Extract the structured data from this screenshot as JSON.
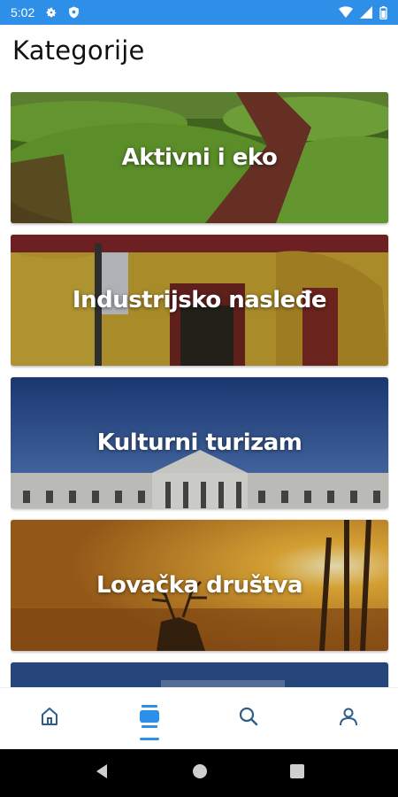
{
  "status_bar": {
    "time": "5:02",
    "icons": [
      "gear-icon",
      "shield-icon",
      "wifi-icon",
      "signal-icon",
      "battery-icon"
    ],
    "background": "#2e8fe8"
  },
  "header": {
    "title": "Kategorije"
  },
  "categories": [
    {
      "label": "Aktivni i eko",
      "image": "green hills with path"
    },
    {
      "label": "Industrijsko nasleđe",
      "image": "yellow historic building"
    },
    {
      "label": "Kulturni turizam",
      "image": "white palace under blue sky"
    },
    {
      "label": "Lovačka društva",
      "image": "deer at sunset"
    },
    {
      "label": "",
      "image": "partially visible card"
    }
  ],
  "bottom_nav": {
    "items": [
      "home-icon",
      "list-icon",
      "search-icon",
      "profile-icon"
    ],
    "active": "list-icon",
    "active_color": "#2e8fe8",
    "inactive_color": "#2f5d8a"
  },
  "android_nav": {
    "items": [
      "back-button",
      "home-button",
      "recents-button"
    ]
  }
}
